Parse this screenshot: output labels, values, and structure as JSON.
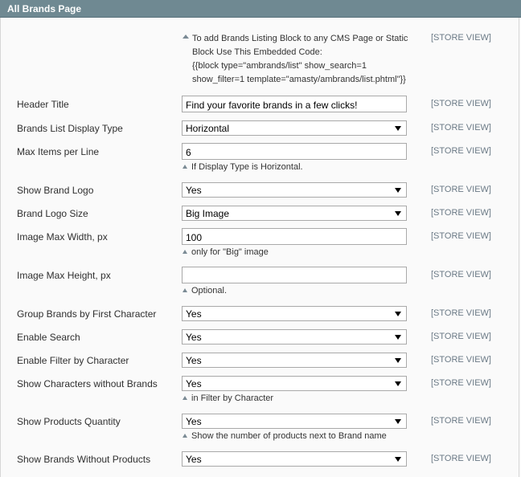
{
  "header": {
    "title": "All Brands Page"
  },
  "info": {
    "lines": [
      "To add Brands Listing Block to any CMS Page or Static",
      "Block Use This Embedded Code:",
      "{{block type=\"ambrands/list\" show_search=1",
      "show_filter=1 template=\"amasty/ambrands/list.phtml\"}}"
    ],
    "scope": "[STORE VIEW]"
  },
  "fields": {
    "header_title": {
      "label": "Header Title",
      "value": "Find your favorite brands in a few clicks!",
      "scope": "[STORE VIEW]"
    },
    "display_type": {
      "label": "Brands List Display Type",
      "value": "Horizontal",
      "scope": "[STORE VIEW]"
    },
    "max_items": {
      "label": "Max Items per Line",
      "value": "6",
      "scope": "[STORE VIEW]",
      "note": "If Display Type is Horizontal."
    },
    "show_logo": {
      "label": "Show Brand Logo",
      "value": "Yes",
      "scope": "[STORE VIEW]"
    },
    "logo_size": {
      "label": "Brand Logo Size",
      "value": "Big Image",
      "scope": "[STORE VIEW]"
    },
    "max_width": {
      "label": "Image Max Width, px",
      "value": "100",
      "scope": "[STORE VIEW]",
      "note": "only for \"Big\" image"
    },
    "max_height": {
      "label": "Image Max Height, px",
      "value": "",
      "scope": "[STORE VIEW]",
      "note": "Optional."
    },
    "group_by_char": {
      "label": "Group Brands by First Character",
      "value": "Yes",
      "scope": "[STORE VIEW]"
    },
    "enable_search": {
      "label": "Enable Search",
      "value": "Yes",
      "scope": "[STORE VIEW]"
    },
    "enable_filter": {
      "label": "Enable Filter by Character",
      "value": "Yes",
      "scope": "[STORE VIEW]"
    },
    "show_chars_without": {
      "label": "Show Characters without Brands",
      "value": "Yes",
      "scope": "[STORE VIEW]",
      "note": "in Filter by Character"
    },
    "show_qty": {
      "label": "Show Products Quantity",
      "value": "Yes",
      "scope": "[STORE VIEW]",
      "note": "Show the number of products next to Brand name"
    },
    "show_without_products": {
      "label": "Show Brands Without Products",
      "value": "Yes",
      "scope": "[STORE VIEW]"
    }
  }
}
